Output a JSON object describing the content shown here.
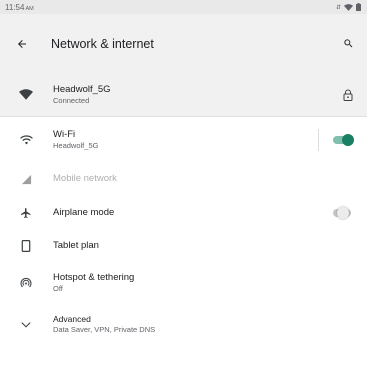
{
  "status_bar": {
    "time": "11:54",
    "ampm": "AM"
  },
  "app_bar": {
    "title": "Network & internet",
    "back_icon": "arrow-back-icon",
    "search_icon": "search-icon"
  },
  "connected_network": {
    "name": "Headwolf_5G",
    "status": "Connected",
    "icon": "wifi-full-icon",
    "lock_icon": "lock-icon"
  },
  "items": [
    {
      "key": "wifi",
      "label": "Wi-Fi",
      "summary": "Headwolf_5G",
      "icon": "wifi-icon",
      "toggle": true,
      "enabled": true
    },
    {
      "key": "mobile",
      "label": "Mobile network",
      "summary": "",
      "icon": "cell-signal-icon",
      "toggle": null,
      "enabled": false
    },
    {
      "key": "airplane",
      "label": "Airplane mode",
      "summary": "",
      "icon": "airplane-icon",
      "toggle": false,
      "enabled": true
    },
    {
      "key": "tablet",
      "label": "Tablet plan",
      "summary": "",
      "icon": "tablet-icon",
      "toggle": null,
      "enabled": true
    },
    {
      "key": "hotspot",
      "label": "Hotspot & tethering",
      "summary": "Off",
      "icon": "hotspot-icon",
      "toggle": null,
      "enabled": true
    },
    {
      "key": "advanced",
      "label": "Advanced",
      "summary": "Data Saver, VPN, Private DNS",
      "icon": "chevron-down-icon",
      "toggle": null,
      "enabled": true
    }
  ],
  "colors": {
    "accent": "#1a7f64",
    "header_bg": "#f1f1f1",
    "status_bg": "#e9e9e9"
  }
}
